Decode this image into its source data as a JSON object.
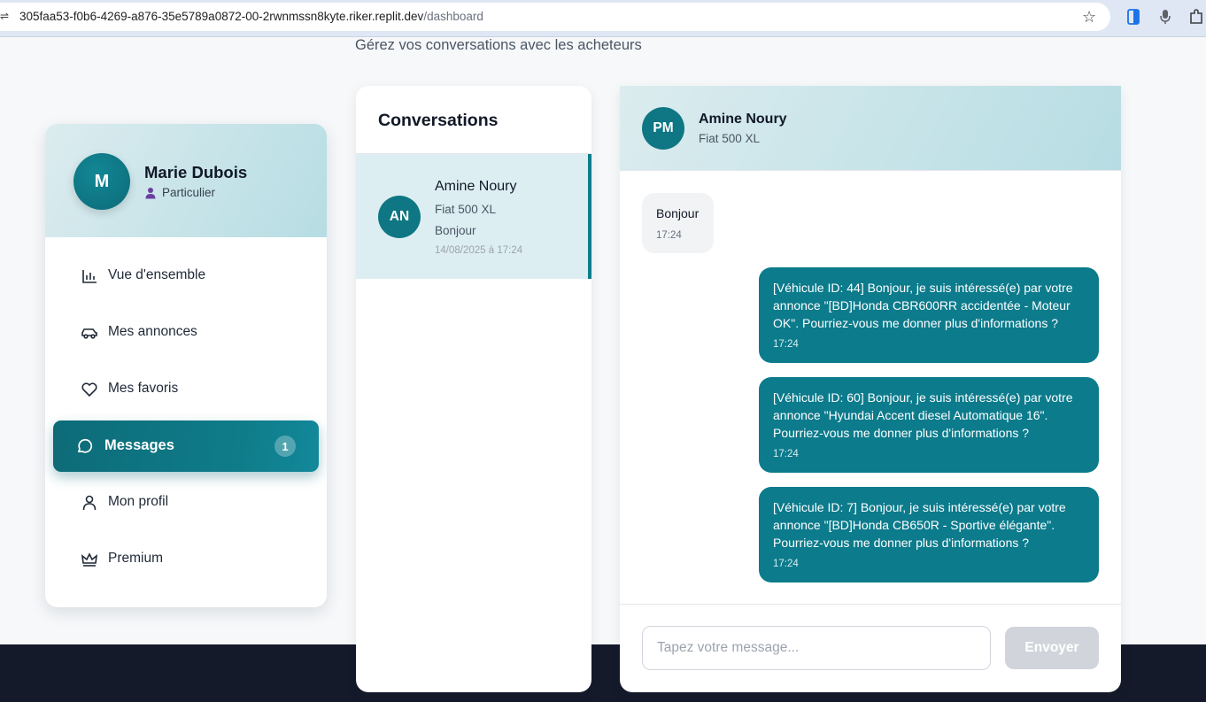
{
  "browser": {
    "url_host": "305faa53-f0b6-4269-a876-35e5789a0872-00-2rwnmssn8kyte.riker.replit.dev",
    "url_path": "/dashboard"
  },
  "page": {
    "subtitle": "Gérez vos conversations avec les acheteurs"
  },
  "user": {
    "initial": "M",
    "name": "Marie Dubois",
    "role": "Particulier"
  },
  "nav": {
    "items": [
      {
        "label": "Vue d'ensemble",
        "icon": "bar-chart-icon"
      },
      {
        "label": "Mes annonces",
        "icon": "car-icon"
      },
      {
        "label": "Mes favoris",
        "icon": "heart-icon"
      },
      {
        "label": "Messages",
        "icon": "message-icon",
        "active": true,
        "badge": "1"
      },
      {
        "label": "Mon profil",
        "icon": "user-icon"
      },
      {
        "label": "Premium",
        "icon": "crown-icon"
      }
    ]
  },
  "conversations": {
    "title": "Conversations",
    "items": [
      {
        "initials": "AN",
        "name": "Amine Noury",
        "vehicle": "Fiat 500 XL",
        "last_message": "Bonjour",
        "date": "14/08/2025 à 17:24"
      }
    ]
  },
  "chat": {
    "initials": "PM",
    "name": "Amine Noury",
    "vehicle": "Fiat 500 XL",
    "messages": [
      {
        "direction": "in",
        "text": "Bonjour",
        "time": "17:24"
      },
      {
        "direction": "out",
        "text": "[Véhicule ID: 44] Bonjour, je suis intéressé(e) par votre annonce \"[BD]Honda CBR600RR accidentée - Moteur OK\". Pourriez-vous me donner plus d'informations ?",
        "time": "17:24"
      },
      {
        "direction": "out",
        "text": "[Véhicule ID: 60] Bonjour, je suis intéressé(e) par votre annonce \"Hyundai Accent diesel Automatique 16\". Pourriez-vous me donner plus d'informations ?",
        "time": "17:24"
      },
      {
        "direction": "out",
        "text": "[Véhicule ID: 7] Bonjour, je suis intéressé(e) par votre annonce \"[BD]Honda CB650R - Sportive élégante\". Pourriez-vous me donner plus d'informations ?",
        "time": "17:24"
      }
    ],
    "input_placeholder": "Tapez votre message...",
    "send_label": "Envoyer"
  },
  "colors": {
    "accent": "#0f7c8a",
    "header_gradient_start": "#dcecef",
    "header_gradient_end": "#b6dde3",
    "footer": "#151a2b"
  }
}
